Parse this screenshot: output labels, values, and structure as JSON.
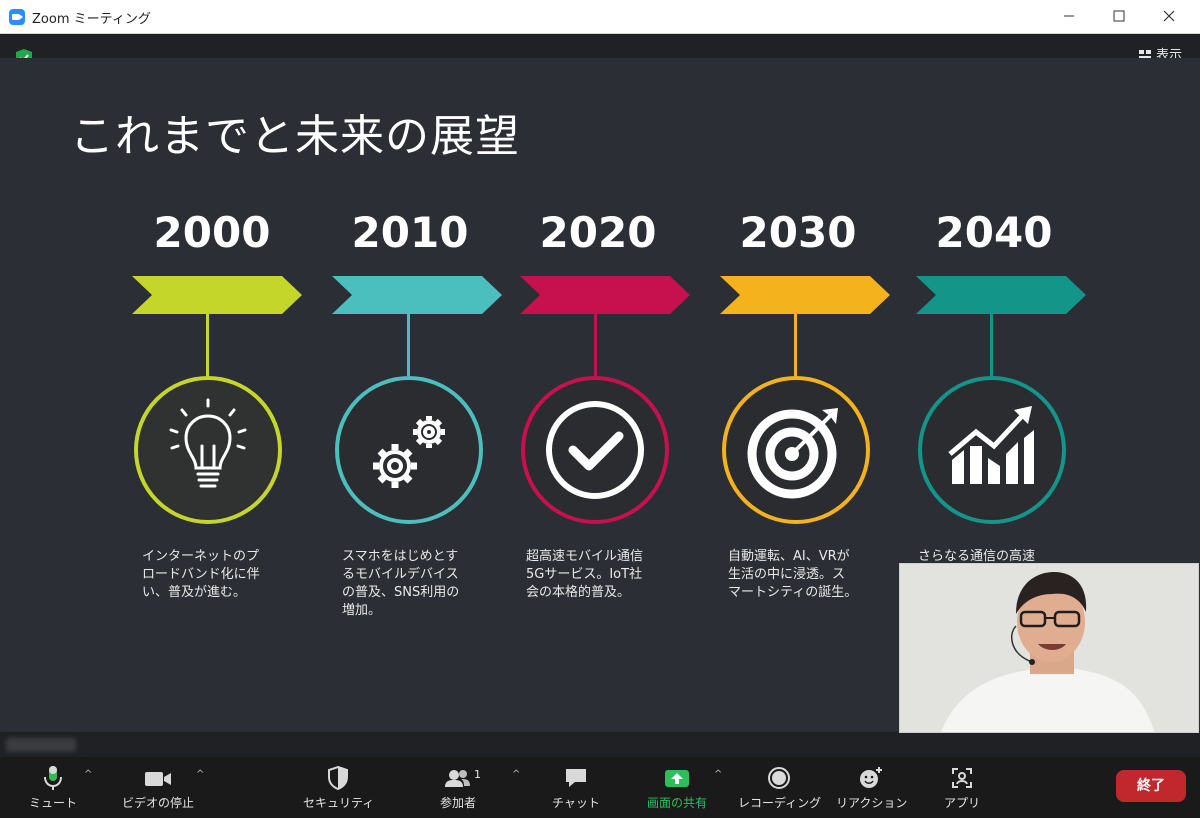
{
  "window": {
    "title": "Zoom ミーティング"
  },
  "view_button": {
    "label": "表示"
  },
  "slide": {
    "title": "これまでと未来の展望",
    "timeline": [
      {
        "year": "2000",
        "color": "#c4d629",
        "icon": "lightbulb-icon",
        "text": "インターネットのプ\nロードバンド化に伴\nい、普及が進む。"
      },
      {
        "year": "2010",
        "color": "#4bbfbd",
        "icon": "gears-icon",
        "text": "スマホをはじめとす\nるモバイルデバイス\nの普及、SNS利用の\n増加。"
      },
      {
        "year": "2020",
        "color": "#c7104e",
        "icon": "checkmark-icon",
        "text": "超高速モバイル通信\n5Gサービス。IoT社\n会の本格的普及。"
      },
      {
        "year": "2030",
        "color": "#f4b21d",
        "icon": "target-icon",
        "text": "自動運転、AI、VRが\n生活の中に浸透。ス\nマートシティの誕生。"
      },
      {
        "year": "2040",
        "color": "#13958a",
        "icon": "growth-chart-icon",
        "text": "さらなる通信の高速"
      }
    ]
  },
  "toolbar": {
    "mute": "ミュート",
    "video": "ビデオの停止",
    "security": "セキュリティ",
    "participants": "参加者",
    "participants_count": "1",
    "chat": "チャット",
    "share": "画面の共有",
    "record": "レコーディング",
    "reaction": "リアクション",
    "apps": "アプリ",
    "end": "終了"
  }
}
